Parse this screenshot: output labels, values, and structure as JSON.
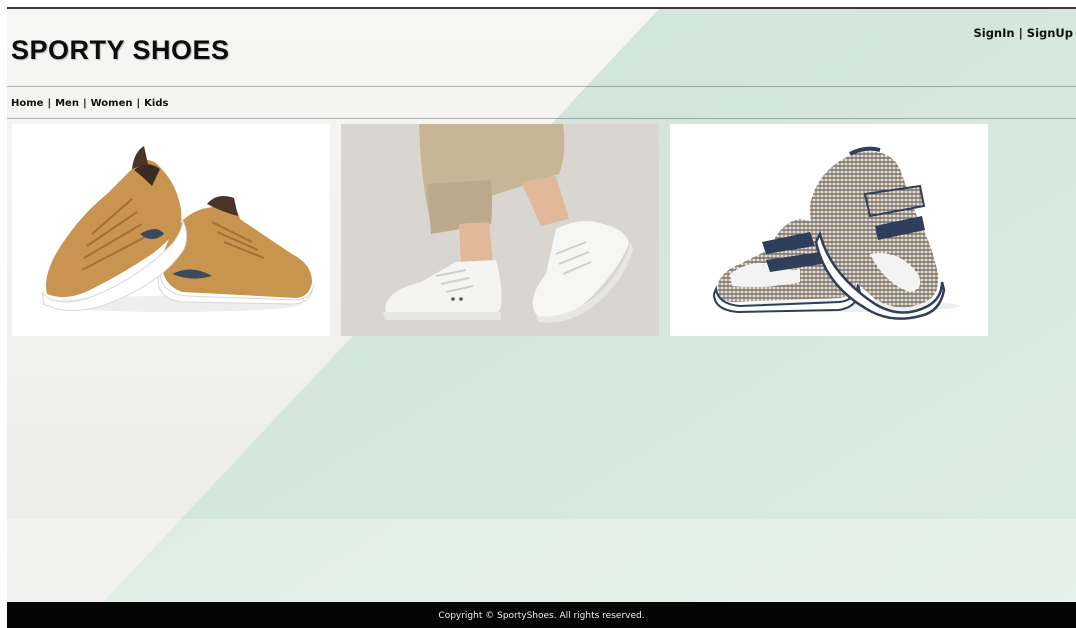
{
  "header": {
    "site_title": "SPORTY SHOES",
    "auth": {
      "signin_label": "SignIn",
      "separator": "|",
      "signup_label": "SignUp"
    }
  },
  "nav": {
    "items": [
      {
        "label": "Home"
      },
      {
        "label": "Men"
      },
      {
        "label": "Women"
      },
      {
        "label": "Kids"
      }
    ],
    "separator": "|"
  },
  "gallery": {
    "tiles": [
      {
        "icon": "tan-sneakers-image"
      },
      {
        "icon": "white-sneakers-on-feet-image"
      },
      {
        "icon": "baby-shoes-image"
      }
    ]
  },
  "footer": {
    "copyright": "Copyright © SportyShoes. All rights reserved."
  },
  "colors": {
    "mint": "#d3e5db",
    "light": "#f3f3f1",
    "footer_bg": "#050505"
  }
}
